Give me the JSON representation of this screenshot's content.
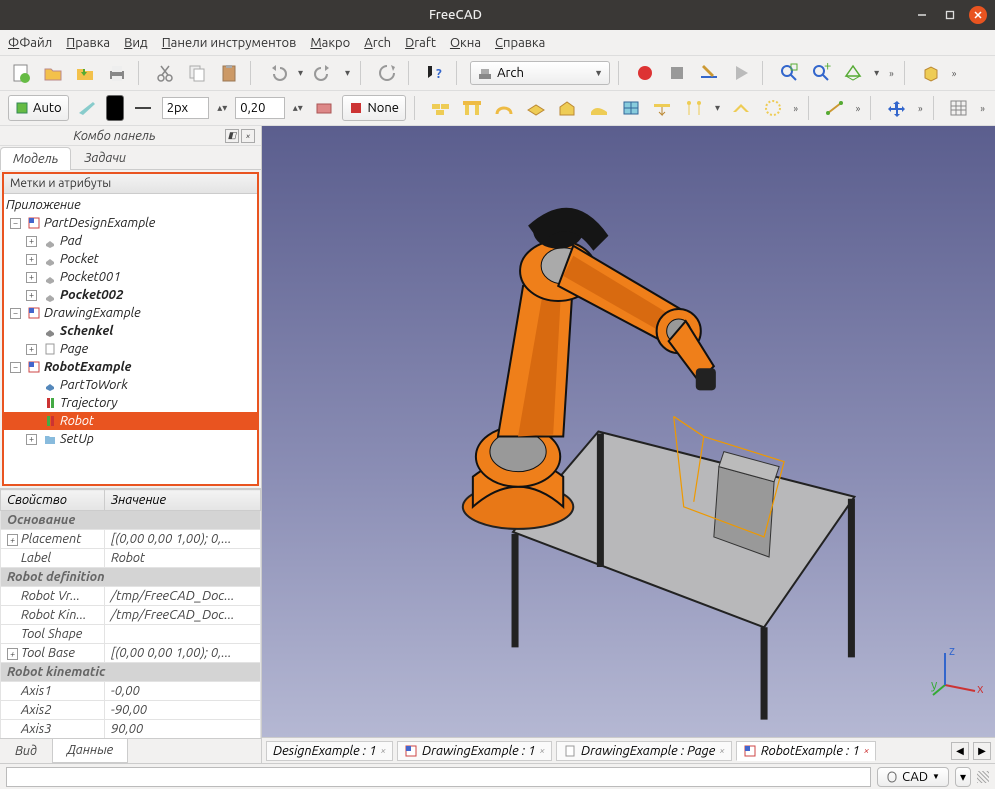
{
  "titlebar": {
    "title": "FreeCAD"
  },
  "menu": {
    "file": "Файл",
    "edit": "Правка",
    "view": "Вид",
    "toolbars": "Панели инструментов",
    "macro": "Макро",
    "arch": "Arch",
    "draft": "Draft",
    "windows": "Окна",
    "help": "Справка"
  },
  "toolbar1": {
    "workbench_label": "Arch"
  },
  "toolbar2": {
    "auto": "Auto",
    "linewidth": "2px",
    "lineval": "0,20",
    "none": "None"
  },
  "combo": {
    "title": "Комбо панель",
    "tab_model": "Модель",
    "tab_tasks": "Задачи",
    "tree_header": "Метки и атрибуты",
    "tree": {
      "root": "Приложение",
      "doc1": "PartDesignExample",
      "d1_pad": "Pad",
      "d1_pocket": "Pocket",
      "d1_pocket001": "Pocket001",
      "d1_pocket002": "Pocket002",
      "doc2": "DrawingExample",
      "d2_schenkel": "Schenkel",
      "d2_page": "Page",
      "doc3": "RobotExample",
      "d3_part": "PartToWork",
      "d3_traj": "Trajectory",
      "d3_robot": "Robot",
      "d3_setup": "SetUp"
    },
    "prop_col1": "Свойство",
    "prop_col2": "Значение",
    "groups": {
      "base": "Основание",
      "robotdef": "Robot definition",
      "robotkin": "Robot kinematic"
    },
    "props": {
      "placement": "Placement",
      "placement_v": "[(0,00 0,00 1,00); 0,...",
      "label": "Label",
      "label_v": "Robot",
      "robotvr": "Robot Vr...",
      "robotvr_v": "/tmp/FreeCAD_Doc...",
      "robotkin": "Robot Kin...",
      "robotkin_v": "/tmp/FreeCAD_Doc...",
      "toolshape": "Tool Shape",
      "toolshape_v": "",
      "toolbase": "Tool Base",
      "toolbase_v": "[(0,00 0,00 1,00); 0,...",
      "axis1": "Axis1",
      "axis1_v": "-0,00",
      "axis2": "Axis2",
      "axis2_v": "-90,00",
      "axis3": "Axis3",
      "axis3_v": "90,00"
    },
    "bottab_view": "Вид",
    "bottab_data": "Данные"
  },
  "doctabs": {
    "t1": "DesignExample : 1",
    "t2": "DrawingExample : 1",
    "t3": "DrawingExample : Page",
    "t4": "RobotExample : 1"
  },
  "status": {
    "cad": "CAD"
  },
  "axes": {
    "x": "x",
    "y": "y",
    "z": "z"
  }
}
